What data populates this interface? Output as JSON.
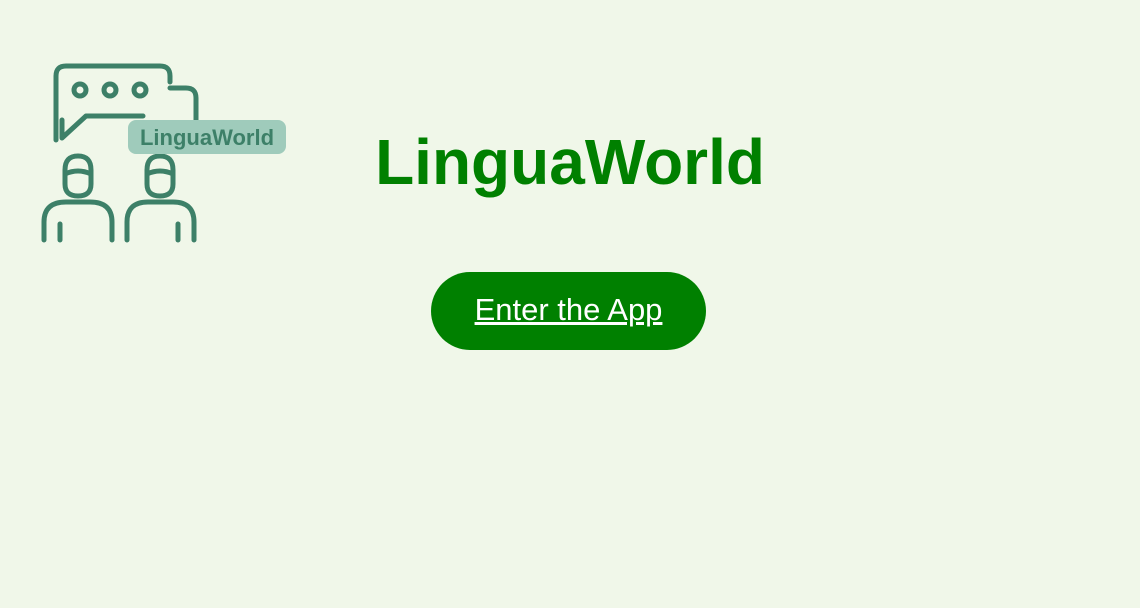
{
  "logo": {
    "text": "LinguaWorld",
    "icon": "chat-people-icon",
    "color": "#3d8068",
    "badge_color": "#9fcbbb"
  },
  "header": {
    "title": "LinguaWorld",
    "title_color": "#008000"
  },
  "cta": {
    "label": "Enter the App",
    "bg_color": "#008000"
  },
  "page": {
    "bg_color": "#f0f7e9"
  }
}
